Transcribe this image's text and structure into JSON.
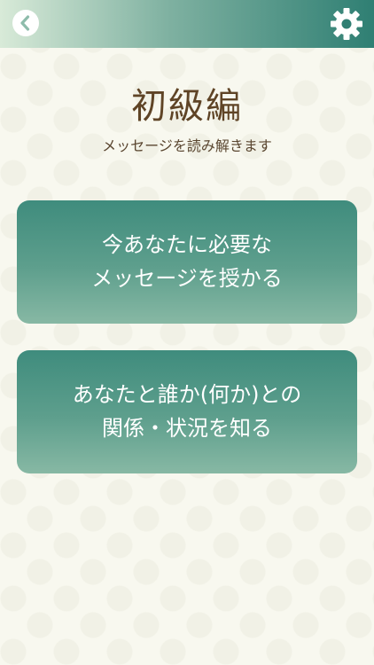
{
  "header": {
    "back_icon": "chevron-left-icon",
    "settings_icon": "gear-icon",
    "accent_color": "#2f7f73"
  },
  "page": {
    "title": "初級編",
    "subtitle": "メッセージを読み解きます"
  },
  "options": [
    {
      "line1": "今あなたに必要な",
      "line2": "メッセージを授かる"
    },
    {
      "line1": "あなたと誰か(何か)との",
      "line2": "関係・状況を知る"
    }
  ],
  "colors": {
    "card_top": "#3f8c7d",
    "card_bottom": "#87b8a4",
    "title": "#5f4426",
    "background": "#f8f8ef"
  }
}
